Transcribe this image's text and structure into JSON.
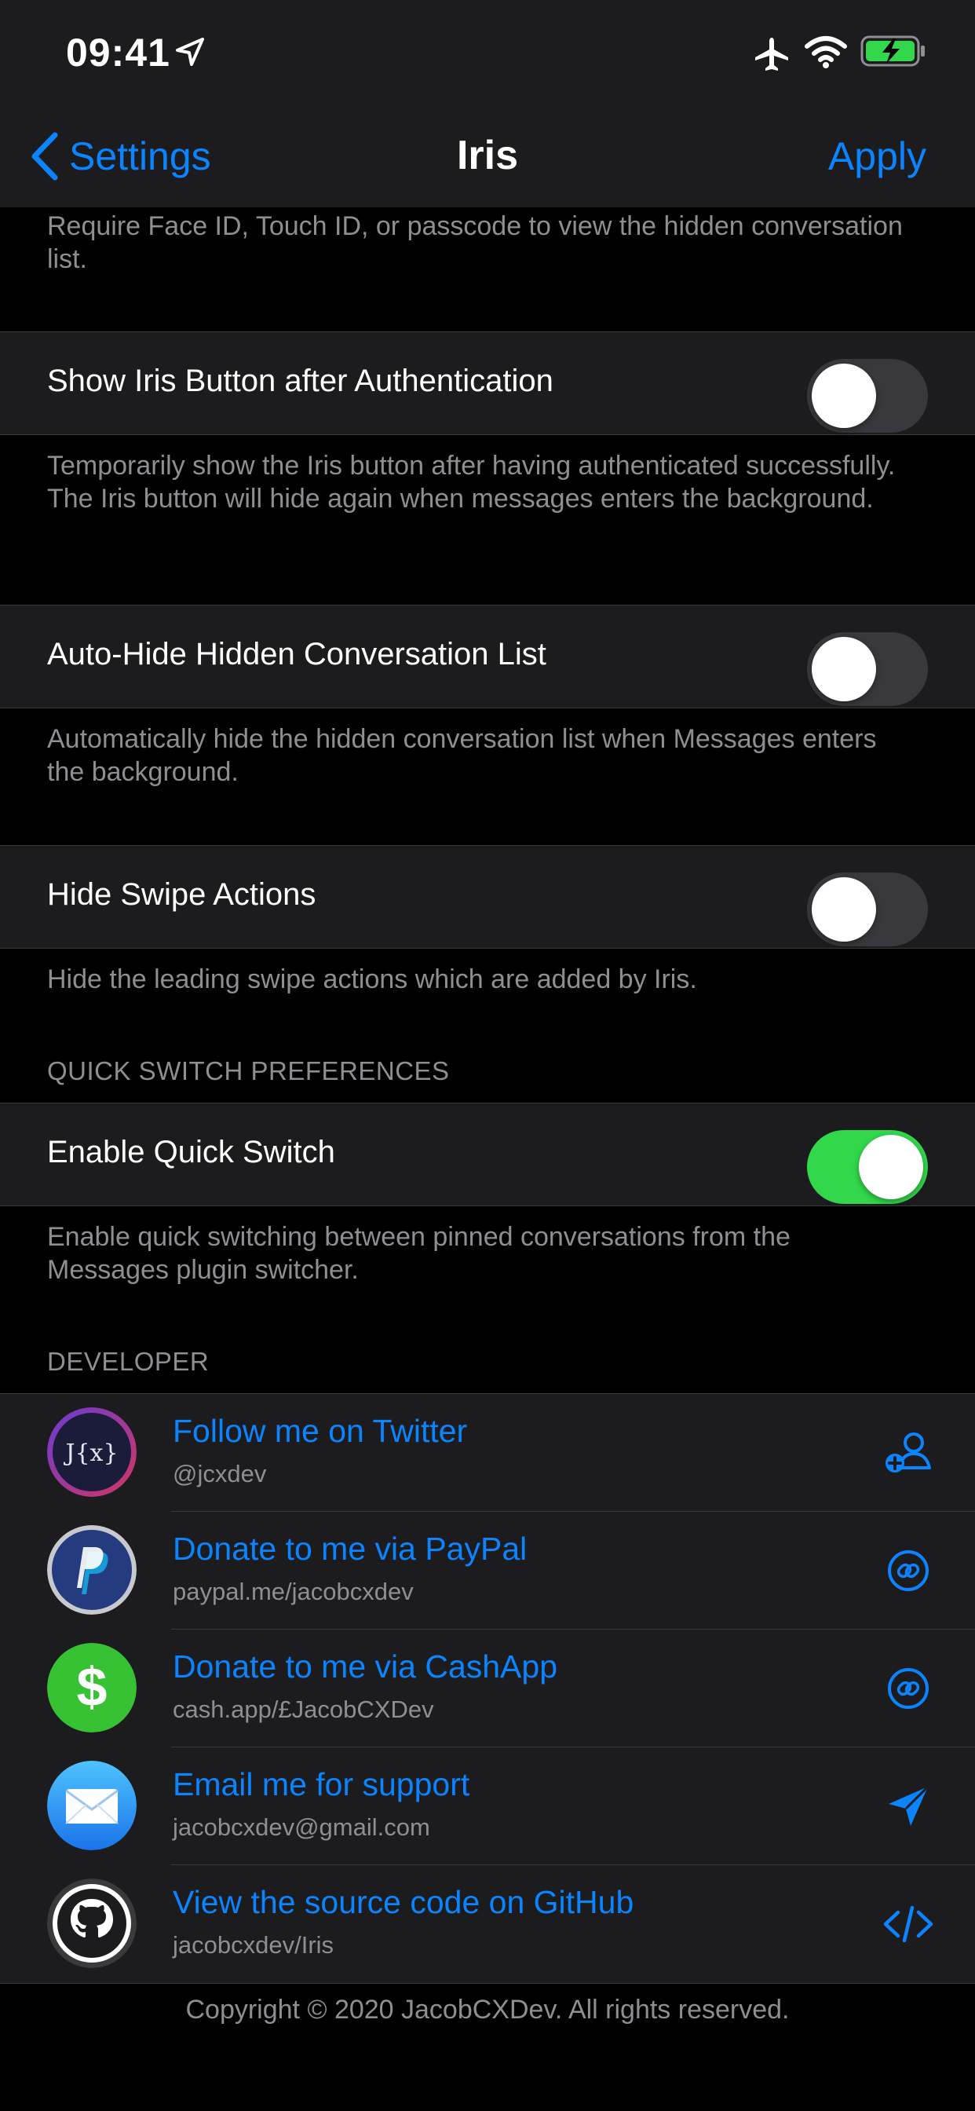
{
  "status_bar": {
    "time": "09:41"
  },
  "nav": {
    "back_label": "Settings",
    "title": "Iris",
    "apply_label": "Apply"
  },
  "intro_footer": "Require Face ID, Touch ID, or passcode to view the hidden conversation list.",
  "settings": [
    {
      "label": "Show Iris Button after Authentication",
      "on": false,
      "footer": "Temporarily show the Iris button after having authenticated successfully. The Iris button will hide again when messages enters the background."
    },
    {
      "label": "Auto-Hide Hidden Conversation List",
      "on": false,
      "footer": "Automatically hide the hidden conversation list when Messages enters the background."
    },
    {
      "label": "Hide Swipe Actions",
      "on": false,
      "footer": "Hide the leading swipe actions which are added by Iris."
    }
  ],
  "quick_switch": {
    "header": "QUICK SWITCH PREFERENCES",
    "label": "Enable Quick Switch",
    "on": true,
    "footer": "Enable quick switching between pinned conversations from the Messages plugin switcher."
  },
  "developer": {
    "header": "DEVELOPER",
    "items": [
      {
        "title": "Follow me on Twitter",
        "subtitle": "@jcxdev",
        "avatar": "jcx-logo",
        "accessory": "add-person-icon"
      },
      {
        "title": "Donate to me via PayPal",
        "subtitle": "paypal.me/jacobcxdev",
        "avatar": "paypal-logo",
        "accessory": "link-icon"
      },
      {
        "title": "Donate to me via CashApp",
        "subtitle": "cash.app/£JacobCXDev",
        "avatar": "cashapp-logo",
        "accessory": "link-icon"
      },
      {
        "title": "Email me for support",
        "subtitle": "jacobcxdev@gmail.com",
        "avatar": "mail-logo",
        "accessory": "send-icon"
      },
      {
        "title": "View the source code on GitHub",
        "subtitle": "jacobcxdev/Iris",
        "avatar": "github-logo",
        "accessory": "code-icon"
      }
    ]
  },
  "copyright": "Copyright © 2020 JacobCXDev. All rights reserved.",
  "colors": {
    "accent": "#0a84ff",
    "toggle_on": "#32d74b",
    "toggle_off": "#39393d",
    "cell_bg": "#1c1c1e",
    "secondary_text": "#8e8e93"
  }
}
